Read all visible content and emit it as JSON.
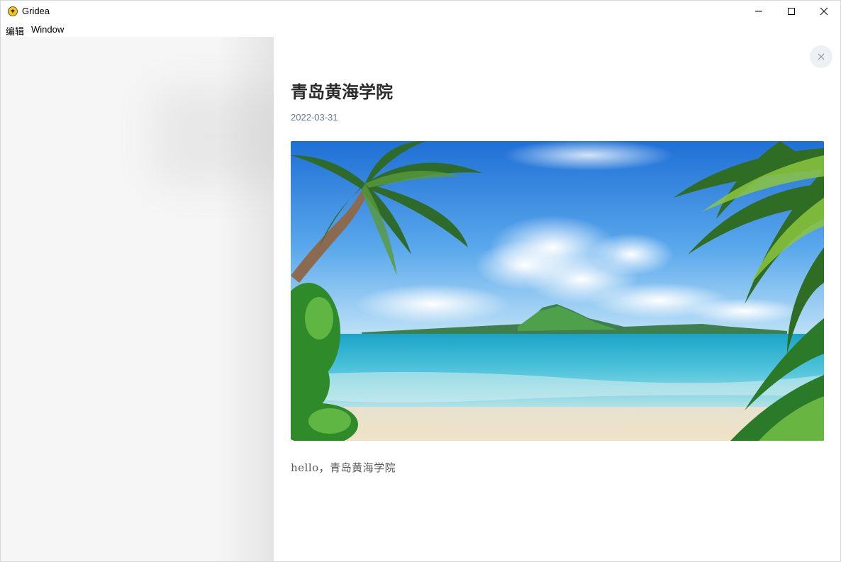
{
  "window": {
    "app_name": "Gridea"
  },
  "menu": {
    "items": [
      "编辑",
      "Window"
    ]
  },
  "post": {
    "title": "青岛黄海学院",
    "date": "2022-03-31",
    "body": "hello，青岛黄海学院",
    "image_subject": "tropical-beach-with-palm-trees"
  },
  "colors": {
    "title_text": "#2b2b2b",
    "date_text": "#6b7a8c",
    "close_button_bg": "#eef1f4",
    "left_pane_bg": "#f6f6f6"
  }
}
